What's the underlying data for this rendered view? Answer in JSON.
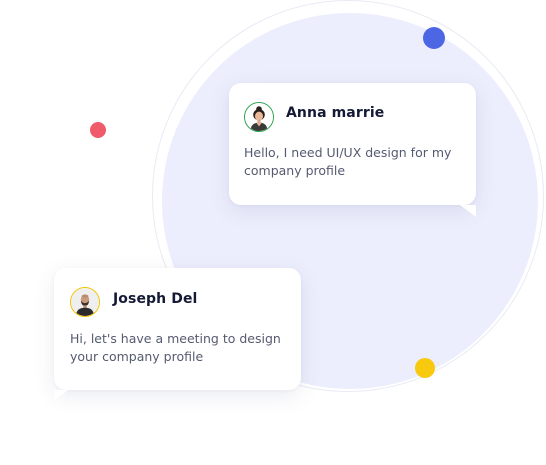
{
  "colors": {
    "backdrop_circle": "#eceefd",
    "dot_blue": "#4c66e4",
    "dot_red": "#ef5b6a",
    "dot_yellow": "#f7c90f",
    "anna_ring": "#2ea44f",
    "joseph_ring": "#f2c300"
  },
  "messages": [
    {
      "sender": "Anna marrie",
      "text": "Hello, I need UI/UX design for my company profile",
      "avatar_icon": "woman-avatar-icon"
    },
    {
      "sender": "Joseph Del",
      "text": "Hi, let's have a meeting to design your company profile",
      "avatar_icon": "man-avatar-icon"
    }
  ]
}
